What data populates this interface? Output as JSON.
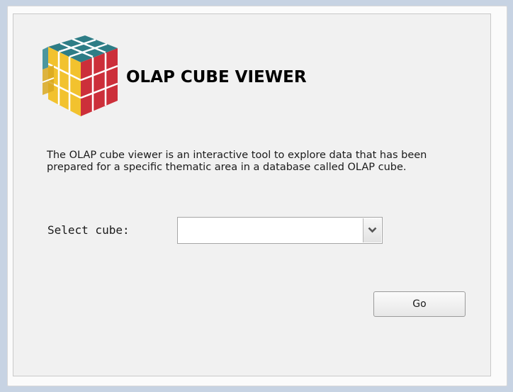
{
  "header": {
    "title": "OLAP CUBE VIEWER",
    "logo_icon": "rubiks-cube-icon"
  },
  "description": "The OLAP cube viewer is an interactive tool to explore data that has been prepared for a specific thematic area in a database called OLAP cube.",
  "cube_select": {
    "label": "Select cube:",
    "selected_value": "",
    "arrow_icon": "chevron-down-icon"
  },
  "actions": {
    "go_label": "Go"
  },
  "colors": {
    "page_background": "#c7d3e3",
    "panel_background": "#f1f1f1",
    "cube_top": "#2e7d86",
    "cube_left": "#f2c22e",
    "cube_right": "#cc2f3a"
  }
}
